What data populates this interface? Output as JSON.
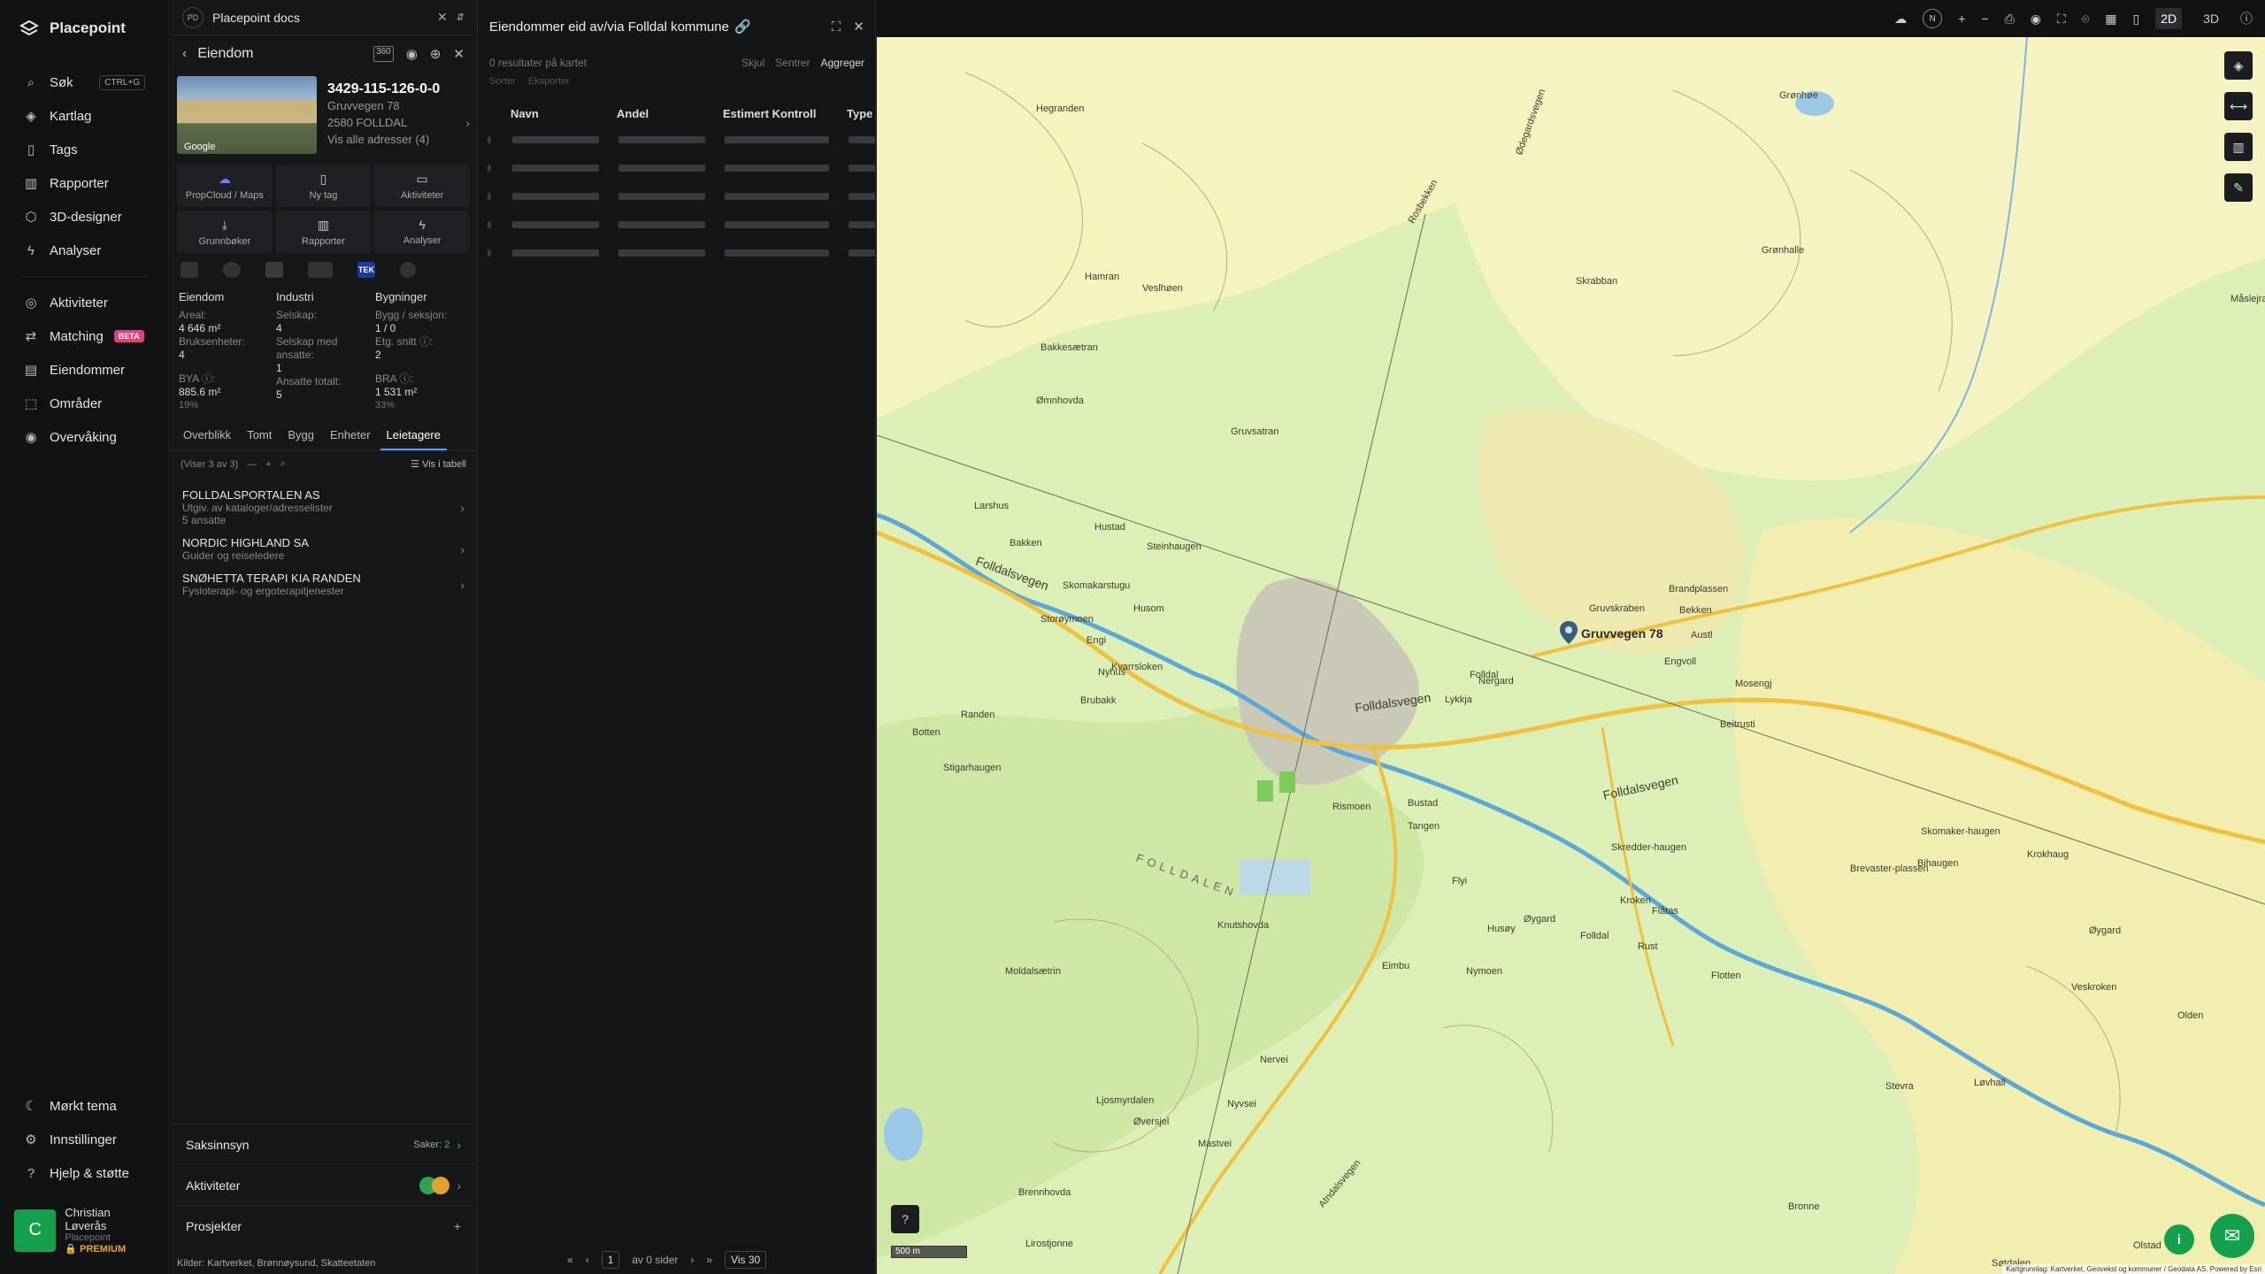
{
  "brand": {
    "name": "Placepoint"
  },
  "nav": {
    "items": [
      {
        "label": "Søk",
        "icon": "search-icon",
        "kbd": "CTRL+G"
      },
      {
        "label": "Kartlag",
        "icon": "layers-icon"
      },
      {
        "label": "Tags",
        "icon": "bookmark-icon"
      },
      {
        "label": "Rapporter",
        "icon": "chart-icon"
      },
      {
        "label": "3D-designer",
        "icon": "cube-icon"
      },
      {
        "label": "Analyser",
        "icon": "bolt-icon"
      }
    ],
    "items2": [
      {
        "label": "Aktiviteter",
        "icon": "target-icon"
      },
      {
        "label": "Matching",
        "icon": "arrows-icon",
        "badge": "BETA"
      },
      {
        "label": "Eiendommer",
        "icon": "building-icon"
      },
      {
        "label": "Områder",
        "icon": "area-icon"
      },
      {
        "label": "Overvåking",
        "icon": "eye-check-icon"
      }
    ],
    "bottom": [
      {
        "label": "Mørkt tema",
        "icon": "moon-icon"
      },
      {
        "label": "Innstillinger",
        "icon": "gear-icon"
      },
      {
        "label": "Hjelp & støtte",
        "icon": "help-icon"
      }
    ],
    "user": {
      "initial": "C",
      "name": "Christian Løverås",
      "org": "Placepoint",
      "plan": "PREMIUM"
    }
  },
  "doc": {
    "badge": "PD",
    "title": "Placepoint docs"
  },
  "property": {
    "header": "Eiendom",
    "id": "3429-115-126-0-0",
    "street": "Gruvvegen 78",
    "postal": "2580 FOLLDAL",
    "all_addresses": "Vis alle adresser (4)",
    "photo_label": "Google",
    "actions": [
      {
        "label": "PropCloud / Maps",
        "icon": "cloud-icon"
      },
      {
        "label": "Ny tag",
        "icon": "bookmark-icon"
      },
      {
        "label": "Aktiviteter",
        "icon": "message-icon"
      },
      {
        "label": "Grunnbøker",
        "icon": "download-icon"
      },
      {
        "label": "Rapporter",
        "icon": "chart-icon"
      },
      {
        "label": "Analyser",
        "icon": "bolt-icon"
      }
    ],
    "tek_label": "TEK",
    "stats": {
      "col1": {
        "title": "Eiendom",
        "rows": [
          {
            "label": "Areal:",
            "value": "4 646 m²"
          },
          {
            "label": "Bruksenheter:",
            "value": "4"
          },
          {
            "label": "BYA ⓘ:",
            "value": "885.6 m²",
            "pct": "19%"
          }
        ]
      },
      "col2": {
        "title": "Industri",
        "rows": [
          {
            "label": "Selskap:",
            "value": "4"
          },
          {
            "label": "Selskap med ansatte:",
            "value": "1"
          },
          {
            "label": "Ansatte totalt:",
            "value": "5"
          }
        ]
      },
      "col3": {
        "title": "Bygninger",
        "rows": [
          {
            "label": "Bygg / seksjon:",
            "value": "1 / 0"
          },
          {
            "label": "Etg. snitt ⓘ:",
            "value": "2"
          },
          {
            "label": "BRA ⓘ:",
            "value": "1 531 m²",
            "pct": "33%"
          }
        ]
      }
    },
    "tabs": [
      "Overblikk",
      "Tomt",
      "Bygg",
      "Enheter",
      "Leietagere"
    ],
    "active_tab": "Leietagere",
    "list": {
      "showing": "(Viser 3 av 3)",
      "view_table": "Vis i tabell"
    },
    "tenants": [
      {
        "name": "FOLLDALSPORTALEN AS",
        "desc": "Utgiv. av kataloger/adresselister",
        "extra": "5 ansatte"
      },
      {
        "name": "NORDIC HIGHLAND SA",
        "desc": "Guider og reiseledere",
        "extra": ""
      },
      {
        "name": "SNØHETTA TERAPI KIA RANDEN",
        "desc": "Fysioterapi- og ergoterapitjenester",
        "extra": ""
      }
    ],
    "sections": [
      {
        "label": "Saksinnsyn",
        "meta_label": "Saker:",
        "meta_value": "2"
      },
      {
        "label": "Aktiviteter"
      },
      {
        "label": "Prosjekter"
      }
    ],
    "sources": {
      "label": "Kilder:",
      "items": [
        "Kartverket,",
        "Brønnøysund,",
        "Skatteetaten"
      ]
    }
  },
  "owned": {
    "title": "Eiendommer eid av/via Folldal kommune",
    "count": "0 resultater på kartet",
    "actions": [
      "Skjul",
      "Sentrer",
      "Aggreger"
    ],
    "actions2": [
      "Sorter",
      "Eksporter"
    ],
    "columns": [
      "Navn",
      "Andel",
      "Estimert Kontroll",
      "Type"
    ],
    "pager": {
      "page": "1",
      "of": "av 0 sider",
      "per": "Vis 30"
    }
  },
  "topbar": {
    "north": "N",
    "view_2d": "2D",
    "view_3d": "3D",
    "mode": "2D"
  },
  "map": {
    "scale": "500 m",
    "attribution": "Kartgrunnlag: Kartverket, Geovekst og kommuner / Geodata AS. Powered by Esri",
    "marker_label": "Gruvvegen 78",
    "labels": [
      "Folldalsvegen",
      "Folldalsvegen",
      "Folldalsvegen",
      "FOLLDALEN",
      "Folldal",
      "Gruvsatran",
      "Hamran",
      "Veslhøen",
      "Hegranden",
      "Bakkesætran",
      "Ømnhovda",
      "Larshus",
      "Bakken",
      "Hustad",
      "Steinhaugen",
      "Skomakarstugu",
      "Storøymoen",
      "Engi",
      "Husom",
      "Nyhus",
      "Brubakk",
      "Randen",
      "Botten",
      "Stigarhaugen",
      "Rismoen",
      "Bustad",
      "Tangen",
      "Nergard",
      "Lykkja",
      "Brandplassen",
      "Bekken",
      "Austl",
      "Engvoll",
      "Mosengj",
      "Beitrusti",
      "Knutshovda",
      "Moldalsætrin",
      "Ljosmyrdalen",
      "Øversjel",
      "Mastvei",
      "Nyvsei",
      "Nervei",
      "Eimbu",
      "Nymoen",
      "Husøy",
      "Øygard",
      "Flyi",
      "Kroken",
      "Folldal",
      "Flåtas",
      "Rust",
      "Flotten",
      "Atndalsvegen",
      "Brennhovda",
      "Lirostjonne",
      "Rosbekken",
      "Skrabban",
      "Grønhøe",
      "Grønhalle",
      "Måslejra",
      "Kvarrsloken",
      "Gruvskraben",
      "Ødegardsvegen",
      "Skredder-haugen",
      "Brevaster-plassen",
      "Skomaker-haugen",
      "Bihaugen",
      "Krokhaug",
      "Øygard",
      "Olden",
      "Veskroken",
      "Olstad",
      "Søtdalen",
      "Bronne",
      "Stevra",
      "Løvhall"
    ]
  }
}
